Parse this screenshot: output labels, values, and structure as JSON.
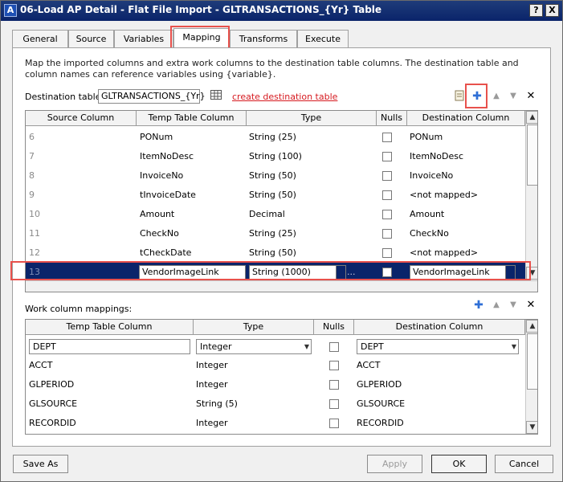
{
  "window": {
    "title": "06-Load AP Detail - Flat File Import - GLTRANSACTIONS_{Yr} Table",
    "help_label": "?",
    "close_label": "X"
  },
  "tabs": [
    {
      "label": "General"
    },
    {
      "label": "Source"
    },
    {
      "label": "Variables"
    },
    {
      "label": "Mapping"
    },
    {
      "label": "Transforms"
    },
    {
      "label": "Execute"
    }
  ],
  "mapping": {
    "description": "Map the imported columns and extra work columns to the destination table columns. The destination table and column names can reference variables using {variable}.",
    "destination_label": "Destination table",
    "destination_value": "GLTRANSACTIONS_{Yr}",
    "create_link": "create destination table",
    "columns": [
      "Source Column",
      "Temp Table Column",
      "Type",
      "Nulls",
      "Destination Column"
    ],
    "rows": [
      {
        "num": "6",
        "temp": "PONum",
        "type": "String (25)",
        "dest": "PONum"
      },
      {
        "num": "7",
        "temp": "ItemNoDesc",
        "type": "String (100)",
        "dest": "ItemNoDesc"
      },
      {
        "num": "8",
        "temp": "InvoiceNo",
        "type": "String (50)",
        "dest": "InvoiceNo"
      },
      {
        "num": "9",
        "temp": "tInvoiceDate",
        "type": "String (50)",
        "dest": "<not mapped>"
      },
      {
        "num": "10",
        "temp": "Amount",
        "type": "Decimal",
        "dest": "Amount"
      },
      {
        "num": "11",
        "temp": "CheckNo",
        "type": "String (25)",
        "dest": "CheckNo"
      },
      {
        "num": "12",
        "temp": "tCheckDate",
        "type": "String (50)",
        "dest": "<not mapped>"
      }
    ],
    "selected_row": {
      "num": "13",
      "temp": "VendorImageLink",
      "type": "String (1000)",
      "ellipsis": "...",
      "dest": "VendorImageLink"
    }
  },
  "work": {
    "label": "Work column mappings:",
    "columns": [
      "Temp Table Column",
      "Type",
      "Nulls",
      "Destination Column"
    ],
    "edit_row": {
      "temp": "DEPT",
      "type": "Integer",
      "dest": "DEPT"
    },
    "rows": [
      {
        "temp": "ACCT",
        "type": "Integer",
        "dest": "ACCT"
      },
      {
        "temp": "GLPERIOD",
        "type": "Integer",
        "dest": "GLPERIOD"
      },
      {
        "temp": "GLSOURCE",
        "type": "String (5)",
        "dest": "GLSOURCE"
      },
      {
        "temp": "RECORDID",
        "type": "Integer",
        "dest": "RECORDID"
      }
    ]
  },
  "buttons": {
    "save_as": "Save As",
    "apply": "Apply",
    "ok": "OK",
    "cancel": "Cancel"
  },
  "colors": {
    "selection": "#0a246a",
    "highlight": "#e8514c",
    "link": "#d6191f",
    "add_icon": "#2f6fd6"
  }
}
